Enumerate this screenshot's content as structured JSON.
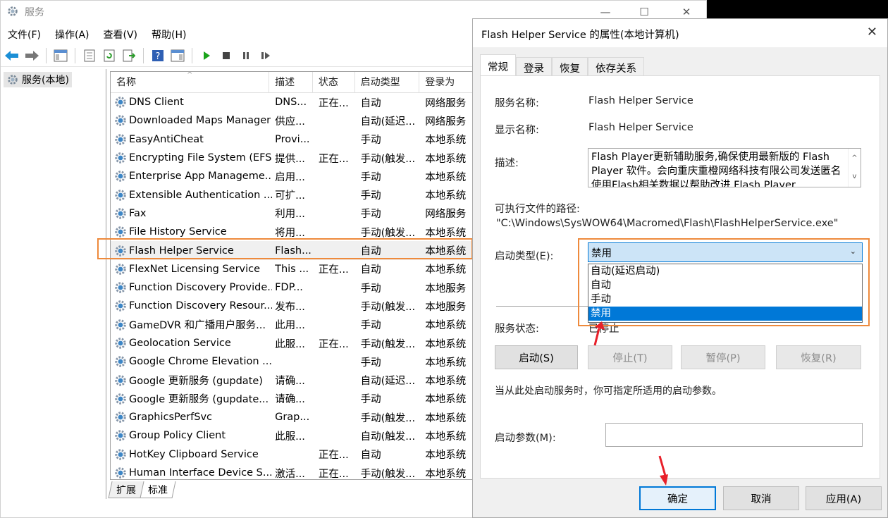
{
  "window": {
    "title": "服务",
    "controls": {
      "minimize": "—",
      "maximize": "☐",
      "close": "✕"
    }
  },
  "menu": [
    "文件(F)",
    "操作(A)",
    "查看(V)",
    "帮助(H)"
  ],
  "tree": {
    "root": "服务(本地)"
  },
  "columns": {
    "name": "名称",
    "description": "描述",
    "status": "状态",
    "startup": "启动类型",
    "logon": "登录为"
  },
  "services": [
    {
      "name": "DNS Client",
      "desc": "DNS...",
      "status": "正在...",
      "startup": "自动",
      "logon": "网络服务"
    },
    {
      "name": "Downloaded Maps Manager",
      "desc": "供应...",
      "status": "",
      "startup": "自动(延迟...",
      "logon": "网络服务"
    },
    {
      "name": "EasyAntiCheat",
      "desc": "Provi...",
      "status": "",
      "startup": "手动",
      "logon": "本地系统"
    },
    {
      "name": "Encrypting File System (EFS)",
      "desc": "提供...",
      "status": "正在...",
      "startup": "手动(触发...",
      "logon": "本地系统"
    },
    {
      "name": "Enterprise App Manageme...",
      "desc": "启用...",
      "status": "",
      "startup": "手动",
      "logon": "本地系统"
    },
    {
      "name": "Extensible Authentication ...",
      "desc": "可扩...",
      "status": "",
      "startup": "手动",
      "logon": "本地系统"
    },
    {
      "name": "Fax",
      "desc": "利用...",
      "status": "",
      "startup": "手动",
      "logon": "网络服务"
    },
    {
      "name": "File History Service",
      "desc": "将用...",
      "status": "",
      "startup": "手动(触发...",
      "logon": "本地系统"
    },
    {
      "name": "Flash Helper Service",
      "desc": "Flash...",
      "status": "",
      "startup": "自动",
      "logon": "本地系统"
    },
    {
      "name": "FlexNet Licensing Service",
      "desc": "This ...",
      "status": "正在...",
      "startup": "自动",
      "logon": "本地系统"
    },
    {
      "name": "Function Discovery Provide...",
      "desc": "FDP...",
      "status": "",
      "startup": "手动",
      "logon": "本地服务"
    },
    {
      "name": "Function Discovery Resour...",
      "desc": "发布...",
      "status": "",
      "startup": "手动(触发...",
      "logon": "本地服务"
    },
    {
      "name": "GameDVR 和广播用户服务...",
      "desc": "此用...",
      "status": "",
      "startup": "手动",
      "logon": "本地系统"
    },
    {
      "name": "Geolocation Service",
      "desc": "此服...",
      "status": "正在...",
      "startup": "手动(触发...",
      "logon": "本地系统"
    },
    {
      "name": "Google Chrome Elevation ...",
      "desc": "",
      "status": "",
      "startup": "手动",
      "logon": "本地系统"
    },
    {
      "name": "Google 更新服务 (gupdate)",
      "desc": "请确...",
      "status": "",
      "startup": "自动(延迟...",
      "logon": "本地系统"
    },
    {
      "name": "Google 更新服务 (gupdate...",
      "desc": "请确...",
      "status": "",
      "startup": "手动",
      "logon": "本地系统"
    },
    {
      "name": "GraphicsPerfSvc",
      "desc": "Grap...",
      "status": "",
      "startup": "手动(触发...",
      "logon": "本地系统"
    },
    {
      "name": "Group Policy Client",
      "desc": "此服...",
      "status": "",
      "startup": "自动(触发...",
      "logon": "本地系统"
    },
    {
      "name": "HotKey Clipboard Service",
      "desc": "",
      "status": "正在...",
      "startup": "自动",
      "logon": "本地系统"
    },
    {
      "name": "Human Interface Device S...",
      "desc": "激活...",
      "status": "正在...",
      "startup": "手动(触发...",
      "logon": "本地系统"
    }
  ],
  "bottom_tabs": [
    "扩展",
    "标准"
  ],
  "dialog": {
    "title": "Flash Helper Service 的属性(本地计算机)",
    "close": "✕",
    "tabs": [
      "常规",
      "登录",
      "恢复",
      "依存关系"
    ],
    "service_name_label": "服务名称:",
    "service_name": "Flash Helper Service",
    "display_name_label": "显示名称:",
    "display_name": "Flash Helper Service",
    "description_label": "描述:",
    "description": "Flash Player更新辅助服务,确保使用最新版的 Flash Player 软件。会向重庆重橙网络科技有限公司发送匿名使用Flash相关数据以帮助改进 Flash Player",
    "path_label": "可执行文件的路径:",
    "path": "\"C:\\Windows\\SysWOW64\\Macromed\\Flash\\FlashHelperService.exe\"",
    "startup_label": "启动类型(E):",
    "startup_selected": "禁用",
    "startup_options": [
      "自动(延迟启动)",
      "自动",
      "手动",
      "禁用"
    ],
    "status_label": "服务状态:",
    "status_value": "已停止",
    "buttons": {
      "start": "启动(S)",
      "stop": "停止(T)",
      "pause": "暂停(P)",
      "resume": "恢复(R)"
    },
    "hint": "当从此处启动服务时，你可指定所适用的启动参数。",
    "param_label": "启动参数(M):",
    "ok": "确定",
    "cancel": "取消",
    "apply": "应用(A)"
  }
}
